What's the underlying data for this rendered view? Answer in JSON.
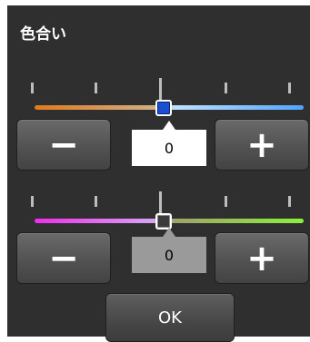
{
  "dialog": {
    "title": "色合い"
  },
  "hue": {
    "value": "0",
    "minus_label": "−",
    "plus_label": "+",
    "track_colors": [
      "#e07a1d",
      "#51a3ff"
    ],
    "thumb_color": "#1b4fd1",
    "position": 0.5
  },
  "saturation": {
    "value": "0",
    "minus_label": "−",
    "plus_label": "+",
    "track_colors": [
      "#ef2df0",
      "#8bf03a"
    ],
    "thumb_color": "#3a3a3a",
    "position": 0.5
  },
  "ok_label": "OK"
}
